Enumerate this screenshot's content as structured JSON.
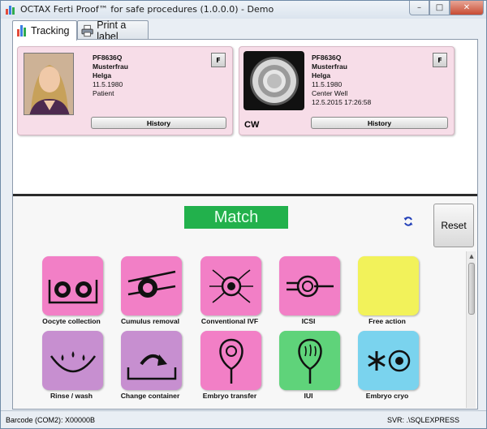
{
  "window": {
    "title": "OCTAX Ferti Proof™ for safe procedures (1.0.0.0) - Demo",
    "controls": {
      "minimize": "–",
      "maximize": "□",
      "close": "✕"
    }
  },
  "tabs": [
    {
      "label": "Tracking",
      "icon": "tracking-chart-icon",
      "active": true
    },
    {
      "label": "Print a label",
      "icon": "printer-icon",
      "active": false
    }
  ],
  "patient_card": {
    "id": "PF8636Q",
    "last_name": "Musterfrau",
    "first_name": "Helga",
    "birth_date": "11.5.1980",
    "role": "Patient",
    "flag_button": "F",
    "history_button": "History",
    "photo": "patient-photo"
  },
  "container_card": {
    "code": "CW",
    "id": "PF8636Q",
    "last_name": "Musterfrau",
    "first_name": "Helga",
    "birth_date": "11.5.1980",
    "container": "Center Well",
    "timestamp": "12.5.2015 17:26:58",
    "flag_button": "F",
    "history_button": "History",
    "image": "center-well-dish"
  },
  "status": {
    "match_label": "Match",
    "match_color": "#22b14c"
  },
  "reset_button": "Reset",
  "actions": [
    {
      "label": "Oocyte collection",
      "color": "#f27fc6",
      "icon": "oocyte-collection-icon"
    },
    {
      "label": "Cumulus removal",
      "color": "#f27fc6",
      "icon": "cumulus-removal-icon"
    },
    {
      "label": "Conventional IVF",
      "color": "#f27fc6",
      "icon": "conventional-ivf-icon"
    },
    {
      "label": "ICSI",
      "color": "#f27fc6",
      "icon": "icsi-icon"
    },
    {
      "label": "Free action",
      "color": "#f2f25a",
      "icon": "free-action-icon"
    },
    {
      "label": "Rinse / wash",
      "color": "#c78fd0",
      "icon": "rinse-wash-icon"
    },
    {
      "label": "Change container",
      "color": "#c78fd0",
      "icon": "change-container-icon"
    },
    {
      "label": "Embryo transfer",
      "color": "#f27fc6",
      "icon": "embryo-transfer-icon"
    },
    {
      "label": "IUI",
      "color": "#5fd37a",
      "icon": "iui-icon"
    },
    {
      "label": "Embryo cryo",
      "color": "#7ad3ee",
      "icon": "embryo-cryo-icon"
    }
  ],
  "statusbar": {
    "barcode": "Barcode (COM2): X00000B",
    "server": "SVR: .\\SQLEXPRESS"
  }
}
